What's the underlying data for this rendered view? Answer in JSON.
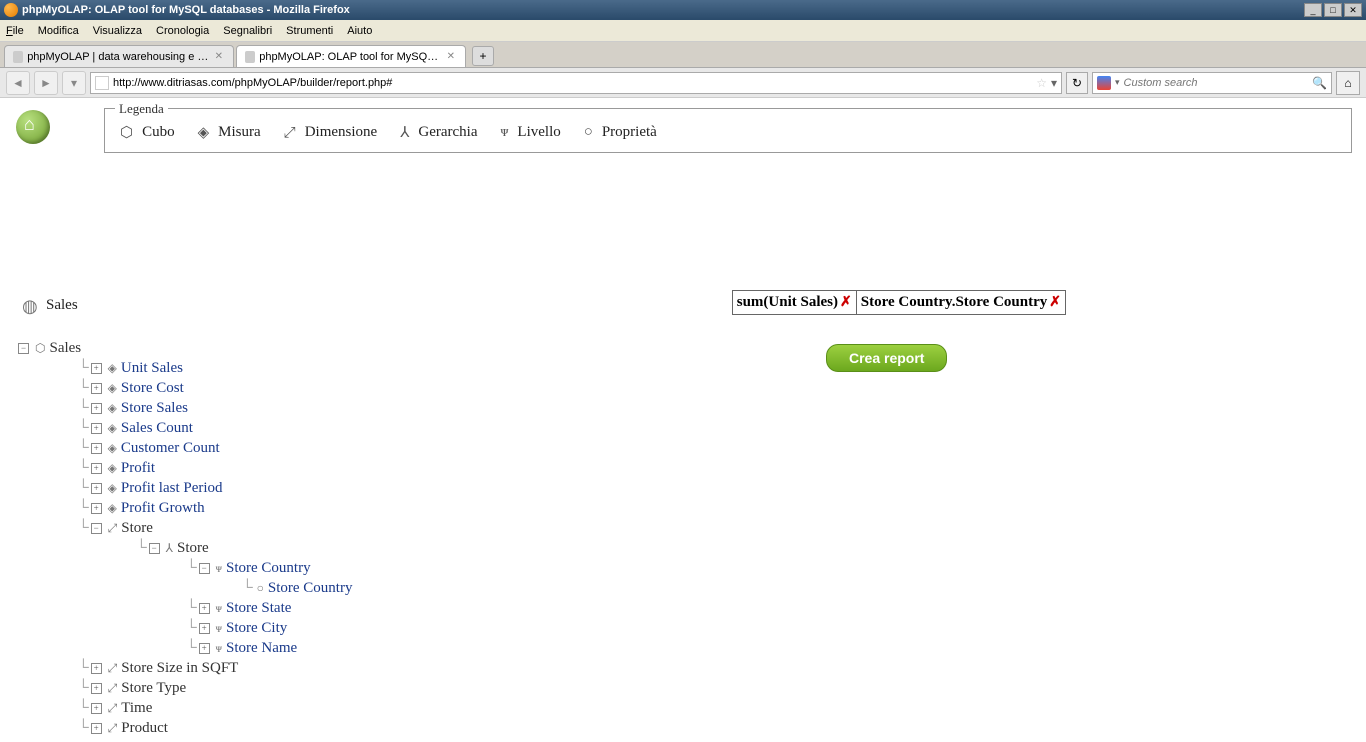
{
  "window": {
    "title": "phpMyOLAP: OLAP tool for MySQL databases - Mozilla Firefox"
  },
  "menu": {
    "file": "File",
    "edit": "Modifica",
    "view": "Visualizza",
    "history": "Cronologia",
    "bookmarks": "Segnalibri",
    "tools": "Strumenti",
    "help": "Aiuto"
  },
  "tabs": {
    "tab1": "phpMyOLAP | data warehousing e analisi ...",
    "tab2": "phpMyOLAP: OLAP tool for MySQL datab..."
  },
  "url": "http://www.ditriasas.com/phpMyOLAP/builder/report.php#",
  "search_placeholder": "Custom search",
  "legend": {
    "title": "Legenda",
    "cubo": "Cubo",
    "misura": "Misura",
    "dimensione": "Dimensione",
    "gerarchia": "Gerarchia",
    "livello": "Livello",
    "proprieta": "Proprietà"
  },
  "cube_name": "Sales",
  "tree": {
    "root": "Sales",
    "measures": {
      "unit_sales": "Unit Sales",
      "store_cost": "Store Cost",
      "store_sales": "Store Sales",
      "sales_count": "Sales Count",
      "customer_count": "Customer Count",
      "profit": "Profit",
      "profit_last": "Profit last Period",
      "profit_growth": "Profit Growth"
    },
    "dims": {
      "store": "Store",
      "store_h": "Store",
      "store_country": "Store Country",
      "store_country_p": "Store Country",
      "store_state": "Store State",
      "store_city": "Store City",
      "store_name": "Store Name",
      "store_size": "Store Size in SQFT",
      "store_type": "Store Type",
      "time": "Time",
      "product": "Product"
    }
  },
  "selection": {
    "measure": "sum(Unit Sales)",
    "dimension": "Store Country.Store Country"
  },
  "create_button": "Crea report"
}
